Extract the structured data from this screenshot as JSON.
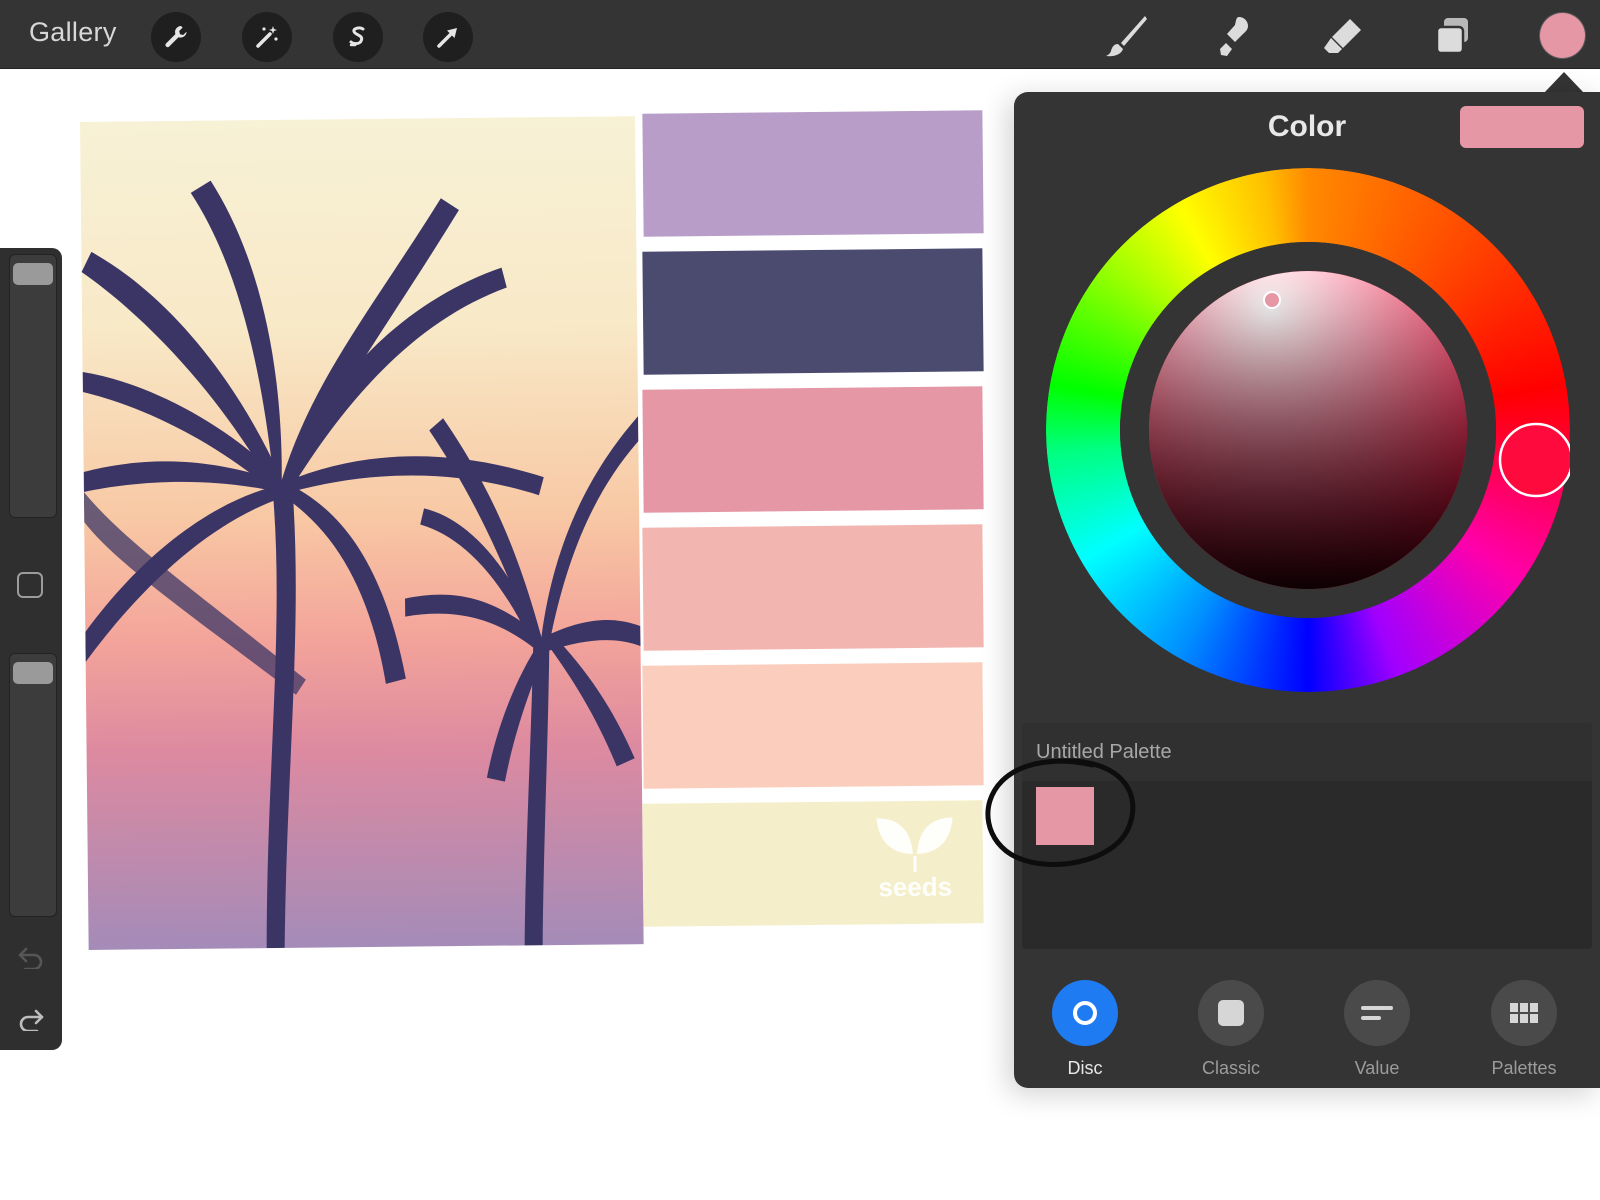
{
  "topbar": {
    "gallery_label": "Gallery",
    "left_tools": [
      "wrench-icon",
      "magic-wand-icon",
      "selection-icon",
      "transform-arrow-icon"
    ],
    "right_tools": [
      "brush-icon",
      "smudge-icon",
      "eraser-icon",
      "layers-icon"
    ],
    "current_color": "#e597a6"
  },
  "sidebar": {
    "size_slider_level": 0.98,
    "opacity_slider_level": 0.98,
    "tools": [
      "modify-square-icon",
      "undo-icon",
      "redo-icon"
    ]
  },
  "canvas": {
    "swatches": [
      "#b89dc8",
      "#4b4b70",
      "#e597a6",
      "#f2b5b0",
      "#fbcdbd",
      "#f4efca"
    ],
    "logo_text": "seeds"
  },
  "color_panel": {
    "title": "Color",
    "current_color": "#e597a6",
    "hue_color": "#ff0a3c",
    "palette": {
      "name": "Untitled Palette",
      "swatches": [
        "#e597a6"
      ]
    },
    "tabs": [
      {
        "label": "Disc",
        "icon": "disc-icon",
        "active": true
      },
      {
        "label": "Classic",
        "icon": "classic-square-icon",
        "active": false
      },
      {
        "label": "Value",
        "icon": "value-sliders-icon",
        "active": false
      },
      {
        "label": "Palettes",
        "icon": "palettes-grid-icon",
        "active": false
      }
    ]
  }
}
